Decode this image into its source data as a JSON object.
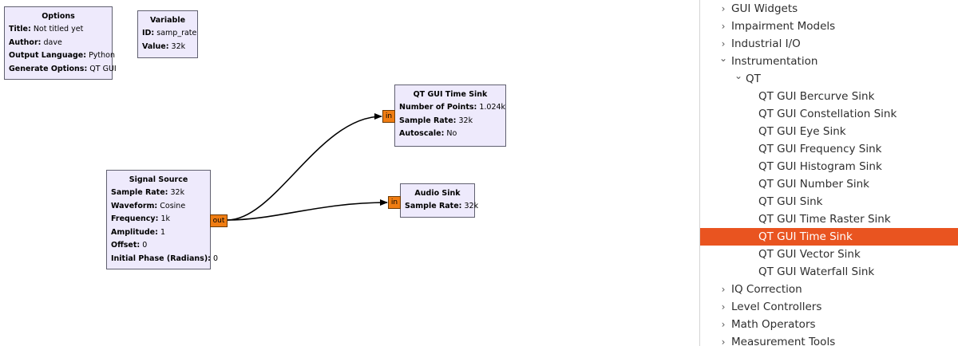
{
  "blocks": {
    "options": {
      "title": "Options",
      "rows": [
        {
          "key": "Title:",
          "value": "Not titled yet"
        },
        {
          "key": "Author:",
          "value": "dave"
        },
        {
          "key": "Output Language:",
          "value": "Python"
        },
        {
          "key": "Generate Options:",
          "value": "QT GUI"
        }
      ]
    },
    "variable": {
      "title": "Variable",
      "rows": [
        {
          "key": "ID:",
          "value": "samp_rate"
        },
        {
          "key": "Value:",
          "value": "32k"
        }
      ]
    },
    "time_sink": {
      "title": "QT GUI Time Sink",
      "port": "in",
      "rows": [
        {
          "key": "Number of Points:",
          "value": "1.024k"
        },
        {
          "key": "Sample Rate:",
          "value": "32k"
        },
        {
          "key": "Autoscale:",
          "value": "No"
        }
      ]
    },
    "audio_sink": {
      "title": "Audio Sink",
      "port": "in",
      "rows": [
        {
          "key": "Sample Rate:",
          "value": "32k"
        }
      ]
    },
    "signal_source": {
      "title": "Signal Source",
      "port": "out",
      "rows": [
        {
          "key": "Sample Rate:",
          "value": "32k"
        },
        {
          "key": "Waveform:",
          "value": "Cosine"
        },
        {
          "key": "Frequency:",
          "value": "1k"
        },
        {
          "key": "Amplitude:",
          "value": "1"
        },
        {
          "key": "Offset:",
          "value": "0"
        },
        {
          "key": "Initial Phase (Radians):",
          "value": "0"
        }
      ]
    }
  },
  "tree": {
    "chevron_right": "›",
    "chevron_down": "⌄",
    "items": [
      {
        "label": "GUI Widgets",
        "state": "collapsed"
      },
      {
        "label": "Impairment Models",
        "state": "collapsed"
      },
      {
        "label": "Industrial I/O",
        "state": "collapsed"
      },
      {
        "label": "Instrumentation",
        "state": "expanded"
      },
      {
        "label": "QT",
        "state": "expanded"
      },
      {
        "label": "QT GUI Bercurve Sink"
      },
      {
        "label": "QT GUI Constellation Sink"
      },
      {
        "label": "QT GUI Eye Sink"
      },
      {
        "label": "QT GUI Frequency Sink"
      },
      {
        "label": "QT GUI Histogram Sink"
      },
      {
        "label": "QT GUI Number Sink"
      },
      {
        "label": "QT GUI Sink"
      },
      {
        "label": "QT GUI Time Raster Sink"
      },
      {
        "label": "QT GUI Time Sink",
        "selected": true
      },
      {
        "label": "QT GUI Vector Sink"
      },
      {
        "label": "QT GUI Waterfall Sink"
      },
      {
        "label": "IQ Correction",
        "state": "collapsed"
      },
      {
        "label": "Level Controllers",
        "state": "collapsed"
      },
      {
        "label": "Math Operators",
        "state": "collapsed"
      },
      {
        "label": "Measurement Tools",
        "state": "collapsed"
      }
    ]
  },
  "colors": {
    "block_fill": "#eeeafc",
    "port_fill": "#f07d12",
    "selection": "#e95420"
  }
}
